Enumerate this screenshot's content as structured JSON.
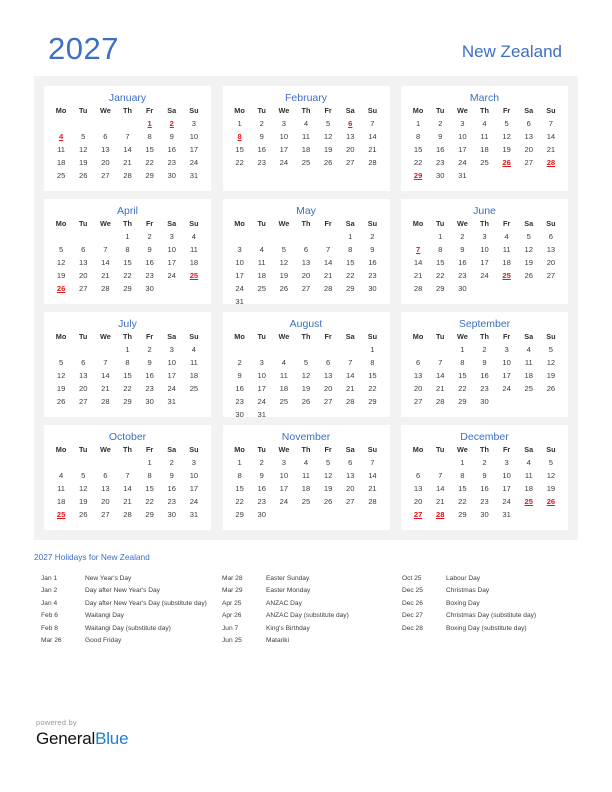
{
  "header": {
    "year": "2027",
    "country": "New Zealand"
  },
  "colors": {
    "accent_blue": "#3d6fc4",
    "holiday_red": "#e8131a",
    "panel_bg": "#f2f2f2",
    "card_bg": "#ffffff",
    "brand_blue": "#1b7fd4"
  },
  "weekday_headers": [
    "Mo",
    "Tu",
    "We",
    "Th",
    "Fr",
    "Sa",
    "Su"
  ],
  "months": [
    {
      "name": "January",
      "lead_blanks": 4,
      "days": 31,
      "holidays": [
        1,
        2,
        4
      ]
    },
    {
      "name": "February",
      "lead_blanks": 0,
      "days": 28,
      "holidays": [
        6,
        8
      ]
    },
    {
      "name": "March",
      "lead_blanks": 0,
      "days": 31,
      "holidays": [
        26,
        28,
        29
      ]
    },
    {
      "name": "April",
      "lead_blanks": 3,
      "days": 30,
      "holidays": [
        25,
        26
      ]
    },
    {
      "name": "May",
      "lead_blanks": 5,
      "days": 31,
      "holidays": []
    },
    {
      "name": "June",
      "lead_blanks": 1,
      "days": 30,
      "holidays": [
        7,
        25
      ]
    },
    {
      "name": "July",
      "lead_blanks": 3,
      "days": 31,
      "holidays": []
    },
    {
      "name": "August",
      "lead_blanks": 6,
      "days": 31,
      "holidays": []
    },
    {
      "name": "September",
      "lead_blanks": 2,
      "days": 30,
      "holidays": []
    },
    {
      "name": "October",
      "lead_blanks": 4,
      "days": 31,
      "holidays": [
        25
      ]
    },
    {
      "name": "November",
      "lead_blanks": 0,
      "days": 30,
      "holidays": []
    },
    {
      "name": "December",
      "lead_blanks": 2,
      "days": 31,
      "holidays": [
        25,
        26,
        27,
        28
      ]
    }
  ],
  "holidays_section": {
    "title": "2027 Holidays for New Zealand",
    "columns": [
      [
        {
          "date": "Jan 1",
          "name": "New Year's Day"
        },
        {
          "date": "Jan 2",
          "name": "Day after New Year's Day"
        },
        {
          "date": "Jan 4",
          "name": "Day after New Year's Day (substitute day)"
        },
        {
          "date": "Feb 6",
          "name": "Waitangi Day"
        },
        {
          "date": "Feb 8",
          "name": "Waitangi Day (substitute day)"
        },
        {
          "date": "Mar 26",
          "name": "Good Friday"
        }
      ],
      [
        {
          "date": "Mar 28",
          "name": "Easter Sunday"
        },
        {
          "date": "Mar 29",
          "name": "Easter Monday"
        },
        {
          "date": "Apr 25",
          "name": "ANZAC Day"
        },
        {
          "date": "Apr 26",
          "name": "ANZAC Day (substitute day)"
        },
        {
          "date": "Jun 7",
          "name": "King's Birthday"
        },
        {
          "date": "Jun 25",
          "name": "Matariki"
        }
      ],
      [
        {
          "date": "Oct 25",
          "name": "Labour Day"
        },
        {
          "date": "Dec 25",
          "name": "Christmas Day"
        },
        {
          "date": "Dec 26",
          "name": "Boxing Day"
        },
        {
          "date": "Dec 27",
          "name": "Christmas Day (substitute day)"
        },
        {
          "date": "Dec 28",
          "name": "Boxing Day (substitute day)"
        }
      ]
    ]
  },
  "brand": {
    "powered_by": "powered by",
    "name_part1": "General",
    "name_part2": "Blue"
  }
}
